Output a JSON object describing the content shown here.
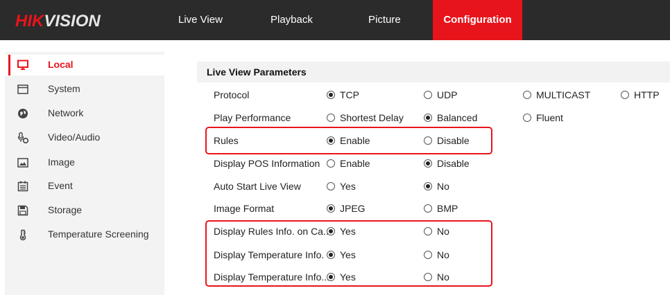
{
  "brand": {
    "hik": "HIK",
    "vision": "VISION"
  },
  "nav": [
    {
      "label": "Live View"
    },
    {
      "label": "Playback"
    },
    {
      "label": "Picture"
    },
    {
      "label": "Configuration",
      "active": true
    }
  ],
  "sidebar": {
    "items": [
      {
        "label": "Local",
        "icon": "monitor-icon",
        "active": true
      },
      {
        "label": "System",
        "icon": "system-icon"
      },
      {
        "label": "Network",
        "icon": "network-globe-icon"
      },
      {
        "label": "Video/Audio",
        "icon": "microphone-camera-icon"
      },
      {
        "label": "Image",
        "icon": "image-icon"
      },
      {
        "label": "Event",
        "icon": "calendar-icon"
      },
      {
        "label": "Storage",
        "icon": "floppy-disk-icon"
      },
      {
        "label": "Temperature Screening",
        "icon": "thermometer-icon"
      }
    ]
  },
  "section": {
    "title": "Live View Parameters"
  },
  "rows": [
    {
      "label": "Protocol",
      "options": [
        {
          "text": "TCP",
          "selected": true
        },
        {
          "text": "UDP",
          "selected": false
        },
        {
          "text": "MULTICAST",
          "selected": false
        },
        {
          "text": "HTTP",
          "selected": false
        }
      ]
    },
    {
      "label": "Play Performance",
      "options": [
        {
          "text": "Shortest Delay",
          "selected": false
        },
        {
          "text": "Balanced",
          "selected": true
        },
        {
          "text": "Fluent",
          "selected": false
        }
      ]
    },
    {
      "label": "Rules",
      "options": [
        {
          "text": "Enable",
          "selected": true
        },
        {
          "text": "Disable",
          "selected": false
        }
      ]
    },
    {
      "label": "Display POS Information",
      "options": [
        {
          "text": "Enable",
          "selected": false
        },
        {
          "text": "Disable",
          "selected": true
        }
      ]
    },
    {
      "label": "Auto Start Live View",
      "options": [
        {
          "text": "Yes",
          "selected": false
        },
        {
          "text": "No",
          "selected": true
        }
      ]
    },
    {
      "label": "Image Format",
      "options": [
        {
          "text": "JPEG",
          "selected": true
        },
        {
          "text": "BMP",
          "selected": false
        }
      ]
    },
    {
      "label": "Display Rules Info. on Ca...",
      "options": [
        {
          "text": "Yes",
          "selected": true
        },
        {
          "text": "No",
          "selected": false
        }
      ]
    },
    {
      "label": "Display Temperature Info.",
      "options": [
        {
          "text": "Yes",
          "selected": true
        },
        {
          "text": "No",
          "selected": false
        }
      ]
    },
    {
      "label": "Display Temperature Info...",
      "options": [
        {
          "text": "Yes",
          "selected": true
        },
        {
          "text": "No",
          "selected": false
        }
      ]
    }
  ],
  "colors": {
    "accent": "#e8141b",
    "topbar": "#2b2b2b",
    "sidebar": "#f3f3f3",
    "header_band": "#f2f2f2"
  }
}
